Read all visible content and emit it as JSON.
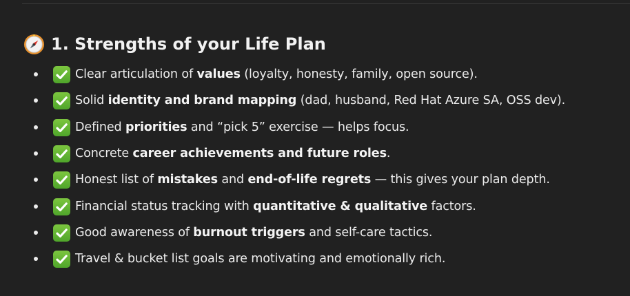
{
  "section": {
    "heading": "1. Strengths of your Life Plan",
    "heading_icon": "compass-icon",
    "item_icon": "check-mark-button-icon",
    "items": [
      {
        "before": "Clear articulation of ",
        "bold": "values",
        "middle": " (loyalty, honesty, family, open source).",
        "bold2": "",
        "after": ""
      },
      {
        "before": "Solid ",
        "bold": "identity and brand mapping",
        "middle": " (dad, husband, Red Hat Azure SA, OSS dev).",
        "bold2": "",
        "after": ""
      },
      {
        "before": "Defined ",
        "bold": "priorities",
        "middle": " and “pick 5” exercise — helps focus.",
        "bold2": "",
        "after": ""
      },
      {
        "before": "Concrete ",
        "bold": "career achievements and future roles",
        "middle": ".",
        "bold2": "",
        "after": ""
      },
      {
        "before": "Honest list of ",
        "bold": "mistakes",
        "middle": " and ",
        "bold2": "end-of-life regrets",
        "after": " — this gives your plan depth."
      },
      {
        "before": "Financial status tracking with ",
        "bold": "quantitative & qualitative",
        "middle": " factors.",
        "bold2": "",
        "after": ""
      },
      {
        "before": "Good awareness of ",
        "bold": "burnout triggers",
        "middle": " and self-care tactics.",
        "bold2": "",
        "after": ""
      },
      {
        "before": "Travel & bucket list goals are motivating and emotionally rich.",
        "bold": "",
        "middle": "",
        "bold2": "",
        "after": ""
      }
    ]
  },
  "colors": {
    "background": "#212121",
    "text": "#ececec",
    "check_green": "#5fb72d"
  }
}
